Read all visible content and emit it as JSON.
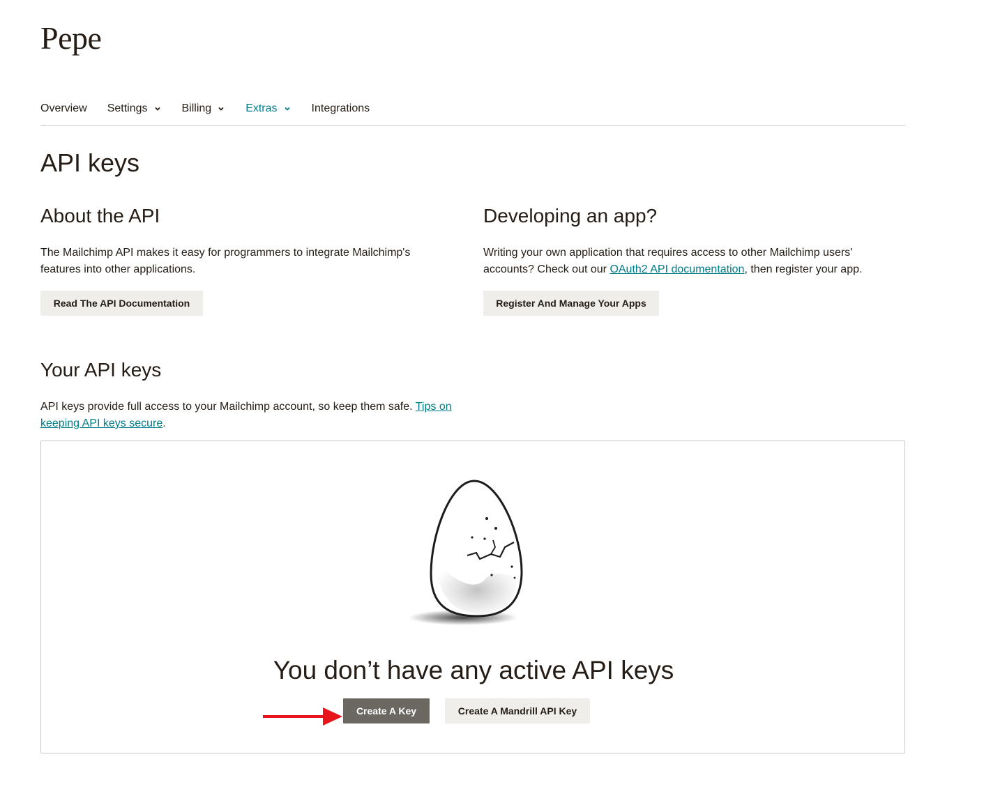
{
  "account": {
    "name": "Pepe"
  },
  "nav": {
    "items": [
      {
        "label": "Overview",
        "has_dropdown": false,
        "active": false
      },
      {
        "label": "Settings",
        "has_dropdown": true,
        "active": false
      },
      {
        "label": "Billing",
        "has_dropdown": true,
        "active": false
      },
      {
        "label": "Extras",
        "has_dropdown": true,
        "active": true
      },
      {
        "label": "Integrations",
        "has_dropdown": false,
        "active": false
      }
    ]
  },
  "page": {
    "title": "API keys"
  },
  "about": {
    "title": "About the API",
    "text": "The Mailchimp API makes it easy for programmers to integrate Mailchimp's features into other applications.",
    "button": "Read The API Documentation"
  },
  "developing": {
    "title": "Developing an app?",
    "text_before": "Writing your own application that requires access to other Mailchimp users' accounts? Check out our ",
    "link": "OAuth2 API documentation",
    "text_after": ", then register your app.",
    "button": "Register And Manage Your Apps"
  },
  "your_keys": {
    "title": "Your API keys",
    "text_before": "API keys provide full access to your Mailchimp account, so keep them safe. ",
    "link": "Tips on keeping API keys secure",
    "text_after": "."
  },
  "empty_state": {
    "illustration": "cracked-egg-illustration",
    "title": "You don’t have any active API keys",
    "primary_button": "Create A Key",
    "secondary_button": "Create A Mandrill API Key",
    "annotation": "red-arrow"
  },
  "colors": {
    "text": "#241c15",
    "accent": "#007c89",
    "secondary_button_bg": "#efeeea",
    "primary_button_bg": "#6b6862",
    "annotation_arrow": "#e8141c"
  }
}
